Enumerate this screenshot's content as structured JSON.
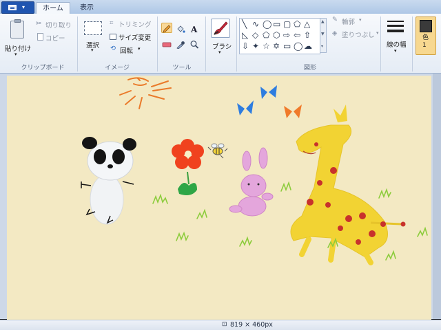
{
  "tabs": {
    "home": "ホーム",
    "view": "表示"
  },
  "clipboard": {
    "paste": "貼り付け",
    "cut": "切り取り",
    "copy": "コピー",
    "label": "クリップボード"
  },
  "image": {
    "select": "選択",
    "crop": "トリミング",
    "resize": "サイズ変更",
    "rotate": "回転",
    "label": "イメージ"
  },
  "tools": {
    "label": "ツール"
  },
  "brushes": {
    "label": "ブラシ"
  },
  "shapes": {
    "outline": "輪郭",
    "fill": "塗りつぶし",
    "label": "図形"
  },
  "size": {
    "label": "線の幅"
  },
  "color": {
    "label": "色 1",
    "value": "#3a3a3a"
  },
  "status": {
    "dimensions": "819 × 460px"
  }
}
